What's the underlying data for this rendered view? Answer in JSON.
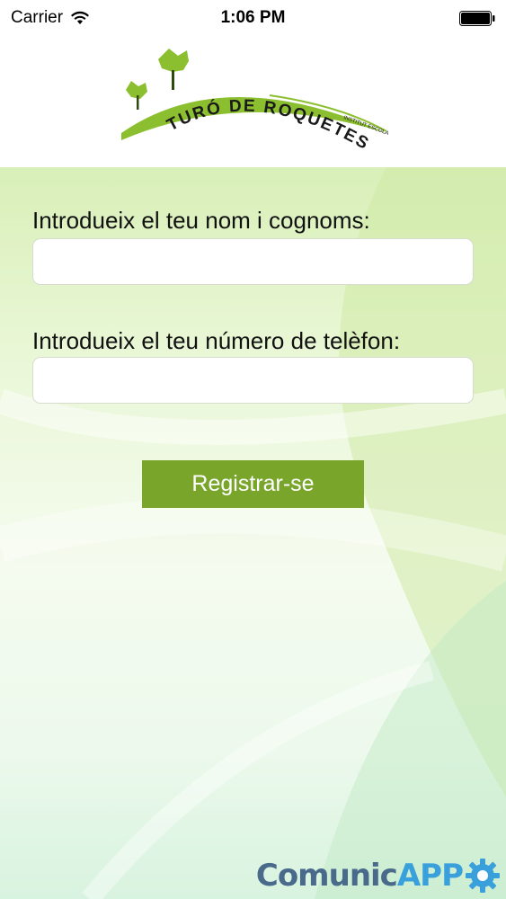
{
  "status_bar": {
    "carrier": "Carrier",
    "time": "1:06 PM"
  },
  "logo": {
    "school_name": "TURÓ DE ROQUETES",
    "tagline": "INSTITUT ESCOLA",
    "colors": {
      "green": "#8bbf2f",
      "text": "#1a1a1a"
    }
  },
  "form": {
    "name_label": "Introdueix el teu nom i cognoms:",
    "name_value": "",
    "phone_label": "Introdueix el teu número de telèfon:",
    "phone_value": "",
    "register_label": "Registrar-se"
  },
  "branding": {
    "comunic": "Comunic",
    "app": "APP",
    "icon": "gear-icon"
  },
  "colors": {
    "button": "#78a52a",
    "background": "#e9f7d6"
  }
}
